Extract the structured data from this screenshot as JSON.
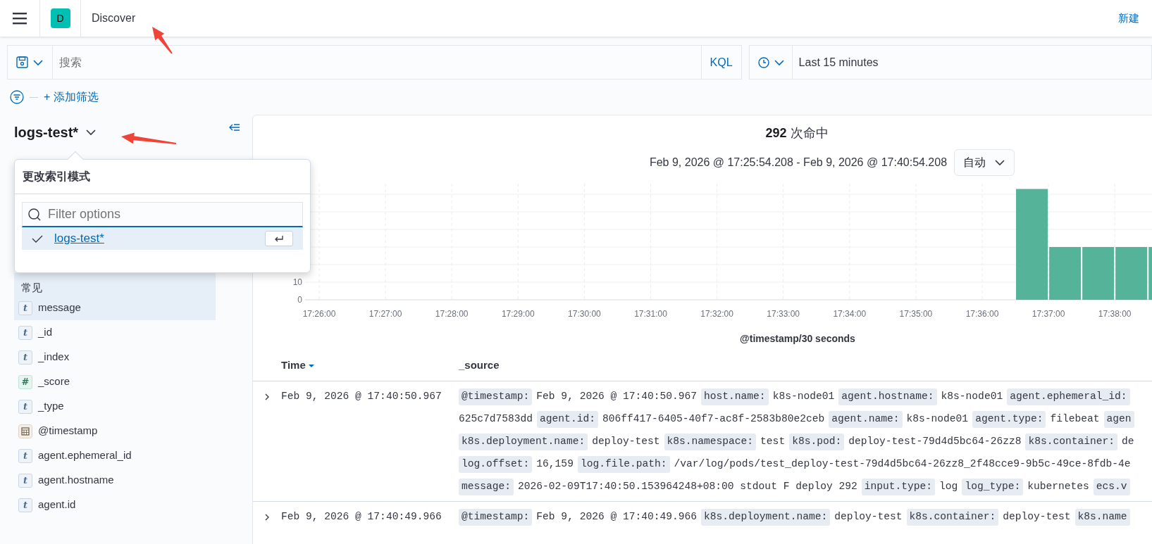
{
  "header": {
    "logo_letter": "D",
    "title": "Discover",
    "new_link": "新建"
  },
  "query_bar": {
    "placeholder": "搜索",
    "language": "KQL",
    "time_range": "Last 15 minutes"
  },
  "filter_bar": {
    "add_filter": "+ 添加筛选"
  },
  "sidebar": {
    "index_pattern": "logs-test*",
    "common_label": "常见",
    "fields": [
      {
        "name": "message",
        "kind": "string",
        "badge": "t",
        "common": true
      },
      {
        "name": "_id",
        "kind": "string",
        "badge": "t",
        "common": false
      },
      {
        "name": "_index",
        "kind": "string",
        "badge": "t",
        "common": false
      },
      {
        "name": "_score",
        "kind": "number",
        "badge": "#",
        "common": false
      },
      {
        "name": "_type",
        "kind": "string",
        "badge": "t",
        "common": false
      },
      {
        "name": "@timestamp",
        "kind": "date",
        "common": false
      },
      {
        "name": "agent.ephemeral_id",
        "kind": "string",
        "badge": "t",
        "common": false
      },
      {
        "name": "agent.hostname",
        "kind": "string",
        "badge": "t",
        "common": false
      },
      {
        "name": "agent.id",
        "kind": "string",
        "badge": "t",
        "common": false
      }
    ]
  },
  "index_popover": {
    "title": "更改索引模式",
    "placeholder": "Filter options",
    "options": [
      {
        "label": "logs-test*",
        "selected": true
      }
    ]
  },
  "histogram": {
    "hits": "292",
    "hits_label": "次命中",
    "range": "Feb 9, 2026 @ 17:25:54.208 - Feb 9, 2026 @ 17:40:54.208",
    "interval": "自动",
    "chart_data": {
      "type": "bar",
      "xlabel": "@timestamp/30 seconds",
      "categories": [
        "17:26:00",
        null,
        "17:27:00",
        null,
        "17:28:00",
        null,
        "17:29:00",
        null,
        "17:30:00",
        null,
        "17:31:00",
        null,
        "17:32:00",
        null,
        "17:33:00",
        null,
        "17:34:00",
        null,
        "17:35:00",
        null,
        "17:36:00",
        null,
        "17:37:00",
        null,
        "17:38:00",
        null
      ],
      "values": [
        0,
        0,
        0,
        0,
        0,
        0,
        0,
        0,
        0,
        0,
        0,
        0,
        0,
        0,
        0,
        0,
        0,
        0,
        0,
        0,
        0,
        63,
        30,
        30,
        30,
        30
      ],
      "grid": true,
      "yticks": [
        0,
        10
      ],
      "ylim": [
        0,
        63
      ]
    }
  },
  "table": {
    "columns": [
      "Time",
      "_source"
    ],
    "rows": [
      {
        "time": "Feb 9, 2026 @ 17:40:50.967",
        "lines": [
          [
            {
              "key": "@timestamp:",
              "value": "Feb 9, 2026 @ 17:40:50.967"
            },
            {
              "key": "host.name:",
              "value": "k8s-node01"
            },
            {
              "key": "agent.hostname:",
              "value": "k8s-node01"
            },
            {
              "key": "agent.ephemeral_id:"
            }
          ],
          [
            {
              "value": "625c7d7583dd"
            },
            {
              "key": "agent.id:",
              "value": "806ff417-6405-40f7-ac8f-2583b80e2ceb"
            },
            {
              "key": "agent.name:",
              "value": "k8s-node01"
            },
            {
              "key": "agent.type:",
              "value": "filebeat"
            },
            {
              "key": "agen"
            }
          ],
          [
            {
              "key": "k8s.deployment.name:",
              "value": "deploy-test"
            },
            {
              "key": "k8s.namespace:",
              "value": "test"
            },
            {
              "key": "k8s.pod:",
              "value": "deploy-test-79d4d5bc64-26zz8"
            },
            {
              "key": "k8s.container:",
              "value": "de"
            }
          ],
          [
            {
              "key": "log.offset:",
              "value": "16,159"
            },
            {
              "key": "log.file.path:",
              "value": "/var/log/pods/test_deploy-test-79d4d5bc64-26zz8_2f48cce9-9b5c-49ce-8fdb-4e"
            }
          ],
          [
            {
              "key": "message:",
              "value": "2026-02-09T17:40:50.153964248+08:00 stdout F deploy 292"
            },
            {
              "key": "input.type:",
              "value": "log"
            },
            {
              "key": "log_type:",
              "value": "kubernetes"
            },
            {
              "key": "ecs.v"
            }
          ]
        ]
      },
      {
        "time": "Feb 9, 2026 @ 17:40:49.966",
        "lines": [
          [
            {
              "key": "@timestamp:",
              "value": "Feb 9, 2026 @ 17:40:49.966"
            },
            {
              "key": "k8s.deployment.name:",
              "value": "deploy-test"
            },
            {
              "key": "k8s.container:",
              "value": "deploy-test"
            },
            {
              "key": "k8s.name"
            }
          ]
        ]
      }
    ]
  }
}
